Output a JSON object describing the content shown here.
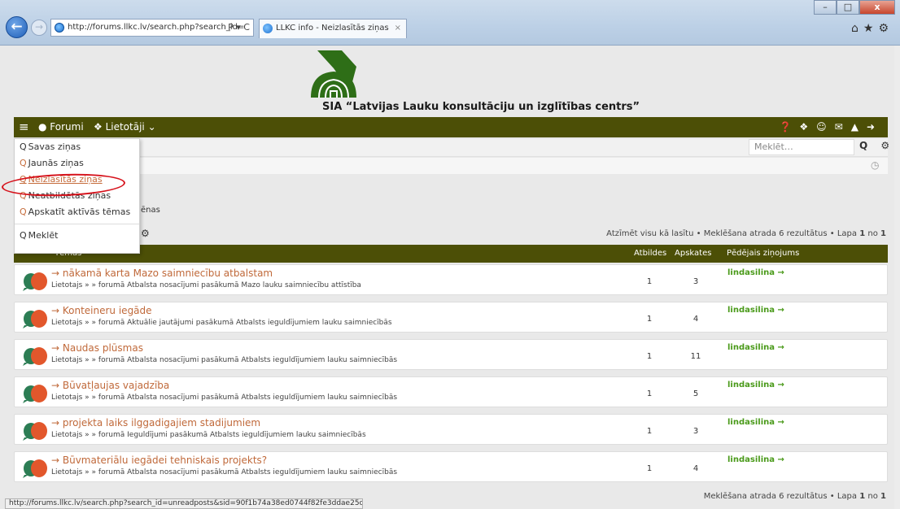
{
  "browser": {
    "address": "http://forums.llkc.lv/search.php?search_id=",
    "address_controls": "Ρ ▾ C",
    "tab_title": "LLKC info - Neizlasītās ziņas",
    "tab_close": "×",
    "min": "–",
    "max": "□",
    "close": "x",
    "toolbar_icons": "⌂★⚙",
    "status_url": "http://forums.llkc.lv/search.php?search_id=unreadposts&sid=90f1b74a38ed0744f82fe3ddae25c6b9"
  },
  "site": {
    "title": "SIA “Latvijas Lauku konsultāciju un izglītības centrs”"
  },
  "nav": {
    "hamburger": "≡",
    "forums": "● Forumi",
    "users": "❖ Lietotāji ⌄",
    "right_icons": "❓❖☺✉▲➜"
  },
  "search": {
    "placeholder": "Meklēt…",
    "icons": "Q ⚙"
  },
  "menu": {
    "items": [
      {
        "label": "Savas ziņas"
      },
      {
        "label": "Jaunās ziņas"
      },
      {
        "label": "Neizlasītās ziņas"
      },
      {
        "label": "Neatbildētās ziņas"
      },
      {
        "label": "Apskatīt aktīvās tēmas"
      }
    ],
    "search_label": "Meklēt"
  },
  "crumb_fragment": "ēnas",
  "tool_fragment": "⚙",
  "pagination": {
    "text": "Atzīmēt visu kā lasītu • Meklēšana atrada 6 rezultātus • Lapa",
    "page": "1",
    "of": "no",
    "total": "1",
    "bottom_text": "Meklēšana atrada 6 rezultātus • Lapa"
  },
  "table": {
    "col_topic": "Tēmas",
    "col_replies": "Atbildes",
    "col_views": "Apskates",
    "col_last": "Pēdējais ziņojums",
    "rows": [
      {
        "title": "→ nākamā karta Mazo saimniecību atbalstam",
        "sub": "Lietotajs » » forumā Atbalsta nosacījumi pasākumā Mazo lauku saimniecību attīstība",
        "replies": "1",
        "views": "3",
        "last": "lindasilina →"
      },
      {
        "title": "→ Konteineru iegāde",
        "sub": "Lietotajs » » forumā Aktuālie jautājumi pasākumā Atbalsts ieguldījumiem lauku saimniecībās",
        "replies": "1",
        "views": "4",
        "last": "lindasilina →"
      },
      {
        "title": "→ Naudas plūsmas",
        "sub": "Lietotajs » » forumā Atbalsta nosacījumi pasākumā Atbalsts ieguldījumiem lauku saimniecībās",
        "replies": "1",
        "views": "11",
        "last": "lindasilina →"
      },
      {
        "title": "→ Būvatļaujas vajadzība",
        "sub": "Lietotajs » » forumā Atbalsta nosacījumi pasākumā Atbalsts ieguldījumiem lauku saimniecībās",
        "replies": "1",
        "views": "5",
        "last": "lindasilina →"
      },
      {
        "title": "→ projekta laiks ilggadigajiem stadijumiem",
        "sub": "Lietotajs » » forumā Ieguldījumi pasākumā Atbalsts ieguldījumiem lauku saimniecībās",
        "replies": "1",
        "views": "3",
        "last": "lindasilina →"
      },
      {
        "title": "→ Būvmateriālu iegādei tehniskais projekts?",
        "sub": "Lietotajs » » forumā Atbalsta nosacījumi pasākumā Atbalsts ieguldījumiem lauku saimniecībās",
        "replies": "1",
        "views": "4",
        "last": "lindasilina →"
      }
    ]
  },
  "colors": {
    "nav_bg": "#4c4f06",
    "link": "#c0693a",
    "user": "#4a9a1a",
    "highlight": "#d6121b"
  }
}
